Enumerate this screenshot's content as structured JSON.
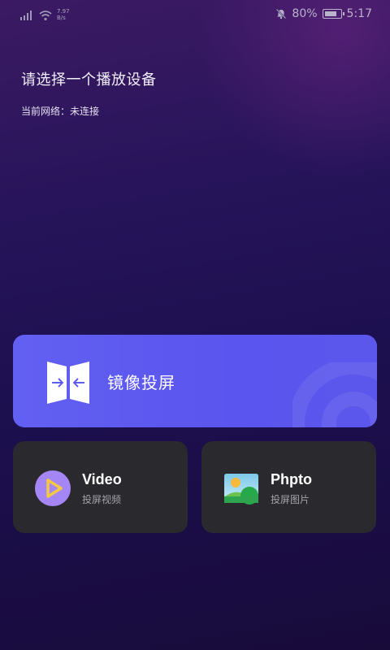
{
  "status_bar": {
    "net_speed_value": "7.97",
    "net_speed_unit": "B/s",
    "battery_percent": "80%",
    "time": "5:17"
  },
  "header": {
    "title": "请选择一个播放设备",
    "network_status": "当前网络：未连接"
  },
  "mirror_card": {
    "label": "镜像投屏",
    "icon": "screen-mirror-icon"
  },
  "video_card": {
    "title": "Video",
    "subtitle": "投屏视频",
    "icon": "play-icon"
  },
  "photo_card": {
    "title": "Phpto",
    "subtitle": "投屏图片",
    "icon": "image-icon"
  },
  "colors": {
    "mirror_card_bg": "#5f5cf0",
    "small_card_bg": "#2a2a2e",
    "play_icon_bg": "#a586f7",
    "play_icon_fg": "#f5c842"
  }
}
